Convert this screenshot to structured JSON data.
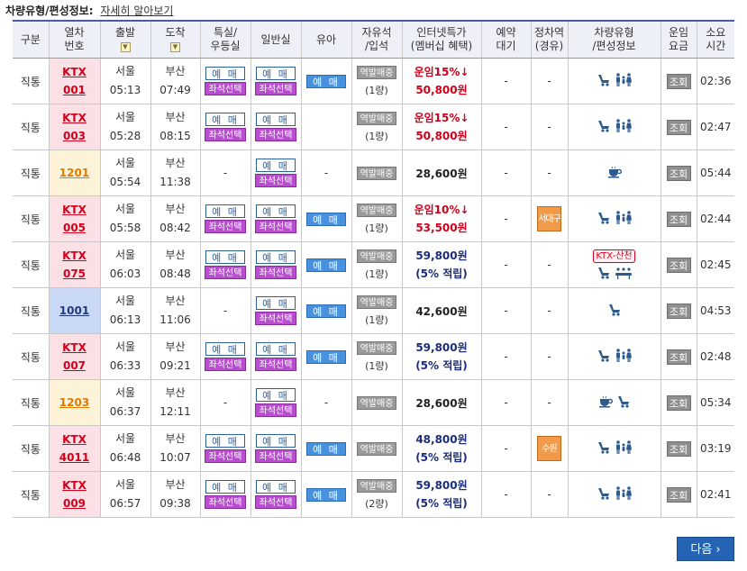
{
  "header": {
    "title": "차량유형/편성정보:",
    "link": "자세히 알아보기"
  },
  "columns": {
    "type": [
      "구분"
    ],
    "train_no": [
      "열차",
      "번호"
    ],
    "depart": [
      "출발",
      "☑"
    ],
    "arrive": [
      "도착",
      "☑"
    ],
    "special": [
      "특실/",
      "우등실"
    ],
    "general": [
      "일반실"
    ],
    "infant": [
      "유아"
    ],
    "free_seat": [
      "자유석",
      "/입석"
    ],
    "internet": [
      "인터넷특가",
      "(멤버십 혜택)"
    ],
    "reserve_wait": [
      "예약",
      "대기"
    ],
    "stop": [
      "정차역",
      "(경유)"
    ],
    "vehicle": [
      "차량유형",
      "/편성정보"
    ],
    "fare": [
      "운임",
      "요금"
    ],
    "duration": [
      "소요",
      "시간"
    ]
  },
  "labels": {
    "buy": "예 매",
    "seat_select": "좌석선택",
    "standby": "역발매중",
    "inquiry": "조회",
    "dash": "-",
    "next": "다음 ›",
    "ktx_sancheon": "KTX-산천"
  },
  "rows": [
    {
      "type": "직통",
      "train": [
        "KTX",
        "001"
      ],
      "dep": [
        "서울",
        "05:13"
      ],
      "arr": [
        "부산",
        "07:49"
      ],
      "special": true,
      "general": true,
      "infant": true,
      "free": "(1량)",
      "fare_lines": [
        "운임15%↓",
        "50,800원"
      ],
      "fare_style": "red",
      "wait": "-",
      "stop": "-",
      "icons": [
        "stroller-icon",
        "family-icon"
      ],
      "duration": "02:36",
      "cls": "ktx"
    },
    {
      "type": "직통",
      "train": [
        "KTX",
        "003"
      ],
      "dep": [
        "서울",
        "05:28"
      ],
      "arr": [
        "부산",
        "08:15"
      ],
      "special": true,
      "general": true,
      "infant": false,
      "free": "(1량)",
      "fare_lines": [
        "운임15%↓",
        "50,800원"
      ],
      "fare_style": "red",
      "wait": "-",
      "stop": "-",
      "icons": [
        "stroller-icon",
        "family-icon"
      ],
      "duration": "02:47",
      "cls": "ktx"
    },
    {
      "type": "직통",
      "train": [
        "1201"
      ],
      "dep": [
        "서울",
        "05:54"
      ],
      "arr": [
        "부산",
        "11:38"
      ],
      "special": false,
      "general": true,
      "infant": false,
      "free": "",
      "fare_lines": [
        "28,600원"
      ],
      "fare_style": "plain",
      "wait": "-",
      "stop": "-",
      "icons": [
        "cafe-icon"
      ],
      "duration": "05:44",
      "cls": "mug"
    },
    {
      "type": "직통",
      "train": [
        "KTX",
        "005"
      ],
      "dep": [
        "서울",
        "05:58"
      ],
      "arr": [
        "부산",
        "08:42"
      ],
      "special": true,
      "general": true,
      "infant": true,
      "free": "(1량)",
      "fare_lines": [
        "운임10%↓",
        "53,500원"
      ],
      "fare_style": "red",
      "wait": "-",
      "stop": "서대구",
      "icons": [
        "stroller-icon",
        "family-icon"
      ],
      "duration": "02:44",
      "cls": "ktx"
    },
    {
      "type": "직통",
      "train": [
        "KTX",
        "075"
      ],
      "dep": [
        "서울",
        "06:03"
      ],
      "arr": [
        "부산",
        "08:48"
      ],
      "special": true,
      "general": true,
      "infant": true,
      "free": "(1량)",
      "fare_lines": [
        "59,800원",
        "(5% 적립)"
      ],
      "fare_style": "blue",
      "wait": "-",
      "stop": "-",
      "icons": [
        "stroller-icon",
        "meeting-room-icon"
      ],
      "sancheon": true,
      "duration": "02:45",
      "cls": "ktx"
    },
    {
      "type": "직통",
      "train": [
        "1001"
      ],
      "dep": [
        "서울",
        "06:13"
      ],
      "arr": [
        "부산",
        "11:06"
      ],
      "special": false,
      "general": true,
      "infant": true,
      "free": "(1량)",
      "fare_lines": [
        "42,600원"
      ],
      "fare_style": "plain",
      "wait": "-",
      "stop": "-",
      "icons": [
        "stroller-icon"
      ],
      "duration": "04:53",
      "cls": "ss"
    },
    {
      "type": "직통",
      "train": [
        "KTX",
        "007"
      ],
      "dep": [
        "서울",
        "06:33"
      ],
      "arr": [
        "부산",
        "09:21"
      ],
      "special": true,
      "general": true,
      "infant": true,
      "free": "(1량)",
      "fare_lines": [
        "59,800원",
        "(5% 적립)"
      ],
      "fare_style": "blue",
      "wait": "-",
      "stop": "-",
      "icons": [
        "stroller-icon",
        "family-icon"
      ],
      "duration": "02:48",
      "cls": "ktx"
    },
    {
      "type": "직통",
      "train": [
        "1203"
      ],
      "dep": [
        "서울",
        "06:37"
      ],
      "arr": [
        "부산",
        "12:11"
      ],
      "special": false,
      "general": true,
      "infant": false,
      "free": "",
      "fare_lines": [
        "28,600원"
      ],
      "fare_style": "plain",
      "wait": "-",
      "stop": "-",
      "icons": [
        "cafe-icon",
        "stroller-icon"
      ],
      "duration": "05:34",
      "cls": "mug"
    },
    {
      "type": "직통",
      "train": [
        "KTX",
        "4011"
      ],
      "dep": [
        "서울",
        "06:48"
      ],
      "arr": [
        "부산",
        "10:07"
      ],
      "special": true,
      "general": true,
      "infant": true,
      "free": "",
      "fare_lines": [
        "48,800원",
        "(5% 적립)"
      ],
      "fare_style": "blue",
      "wait": "-",
      "stop": "수원",
      "icons": [
        "stroller-icon",
        "family-icon"
      ],
      "duration": "03:19",
      "cls": "ktx"
    },
    {
      "type": "직통",
      "train": [
        "KTX",
        "009"
      ],
      "dep": [
        "서울",
        "06:57"
      ],
      "arr": [
        "부산",
        "09:38"
      ],
      "special": true,
      "general": true,
      "infant": true,
      "free": "(2량)",
      "fare_lines": [
        "59,800원",
        "(5% 적립)"
      ],
      "fare_style": "blue",
      "wait": "-",
      "stop": "-",
      "icons": [
        "stroller-icon",
        "family-icon"
      ],
      "duration": "02:41",
      "cls": "ktx"
    }
  ]
}
